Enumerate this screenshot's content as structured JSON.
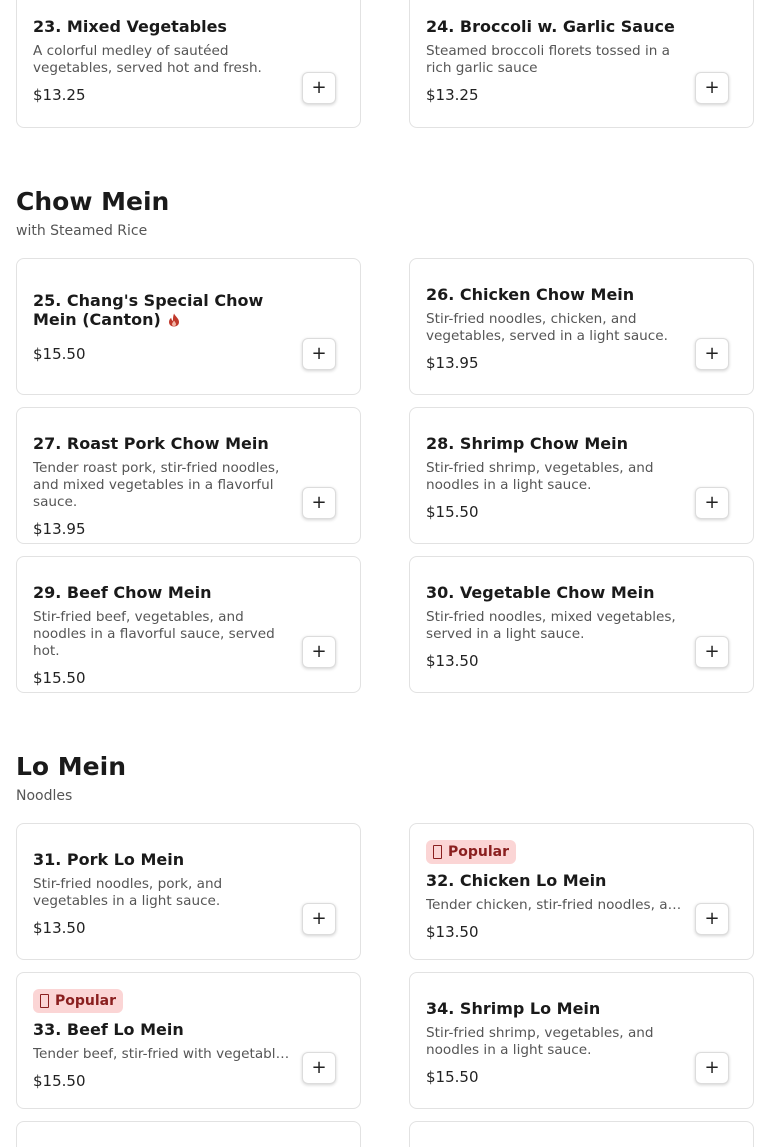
{
  "items": {
    "i23": {
      "name": "23. Mixed Vegetables",
      "desc": "A colorful medley of sautéed vegetables, served hot and fresh.",
      "price": "$13.25",
      "add": "+"
    },
    "i24": {
      "name": "24. Broccoli w. Garlic Sauce",
      "desc": "Steamed broccoli florets tossed in a rich garlic sauce",
      "price": "$13.25",
      "add": "+"
    },
    "i25": {
      "name": "25. Chang's Special Chow Mein (Canton)",
      "price": "$15.50",
      "add": "+",
      "icon": "spicy-icon"
    },
    "i26": {
      "name": "26. Chicken Chow Mein",
      "desc": "Stir-fried noodles, chicken, and vegetables, served in a light sauce.",
      "price": "$13.95",
      "add": "+"
    },
    "i27": {
      "name": "27. Roast Pork Chow Mein",
      "desc": "Tender roast pork, stir-fried noodles, and mixed vegetables in a flavorful sauce.",
      "price": "$13.95",
      "add": "+"
    },
    "i28": {
      "name": "28. Shrimp Chow Mein",
      "desc": "Stir-fried shrimp, vegetables, and noodles in a light sauce.",
      "price": "$15.50",
      "add": "+"
    },
    "i29": {
      "name": "29. Beef Chow Mein",
      "desc": "Stir-fried beef, vegetables, and noodles in a flavorful sauce, served hot.",
      "price": "$15.50",
      "add": "+"
    },
    "i30": {
      "name": "30. Vegetable Chow Mein",
      "desc": "Stir-fried noodles, mixed vegetables, served in a light sauce.",
      "price": "$13.50",
      "add": "+"
    },
    "i31": {
      "name": "31. Pork Lo Mein",
      "desc": "Stir-fried noodles, pork, and vegetables in a light sauce.",
      "price": "$13.50",
      "add": "+"
    },
    "i32": {
      "name": "32. Chicken Lo Mein",
      "desc": "Tender chicken, stir-fried noodles, and...",
      "price": "$13.50",
      "add": "+",
      "badge": "Popular"
    },
    "i33": {
      "name": "33. Beef Lo Mein",
      "desc": "Tender beef, stir-fried with vegetables and...",
      "price": "$15.50",
      "add": "+",
      "badge": "Popular"
    },
    "i34": {
      "name": "34. Shrimp Lo Mein",
      "desc": "Stir-fried shrimp, vegetables, and noodles in a light sauce.",
      "price": "$15.50",
      "add": "+"
    }
  },
  "sections": {
    "chow_mein": {
      "title": "Chow Mein",
      "subtitle": "with Steamed Rice"
    },
    "lo_mein": {
      "title": "Lo Mein",
      "subtitle": "Noodles"
    }
  },
  "colors": {
    "badge_bg": "#fbd5d5",
    "badge_text": "#8a1f1f",
    "spicy": "#c0392b"
  }
}
